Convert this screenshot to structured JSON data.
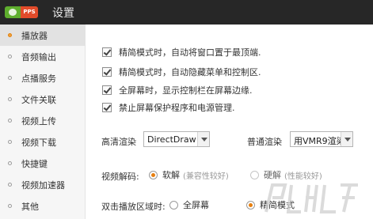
{
  "window": {
    "title": "设置",
    "logo": {
      "badge_text": "PPS",
      "colors": [
        "#5fae2e",
        "#e24b2a"
      ]
    }
  },
  "sidebar": {
    "items": [
      {
        "label": "播放器",
        "active": true
      },
      {
        "label": "音频输出"
      },
      {
        "label": "点播服务"
      },
      {
        "label": "文件关联"
      },
      {
        "label": "视频上传"
      },
      {
        "label": "视频下载"
      },
      {
        "label": "快捷键"
      },
      {
        "label": "视频加速器"
      },
      {
        "label": "其他"
      }
    ]
  },
  "options": [
    {
      "label": "精简模式时，自动将窗口置于最顶端.",
      "checked": true
    },
    {
      "label": "精简模式时，自动隐藏菜单和控制区.",
      "checked": true
    },
    {
      "label": "全屏幕时，显示控制栏在屏幕边缘.",
      "checked": true
    },
    {
      "label": "禁止屏幕保护程序和电源管理.",
      "checked": true
    }
  ],
  "render": {
    "hd_label": "高清渲染",
    "hd_value": "DirectDraw",
    "normal_label": "普通渲染",
    "normal_value": "用VMR9渲染"
  },
  "decode": {
    "label": "视频解码:",
    "soft_label": "软解",
    "soft_note": "(兼容性较好)",
    "hard_label": "硬解",
    "hard_note": "(性能较好)",
    "selected": "soft"
  },
  "dblclick": {
    "label": "双击播放区域时:",
    "fullscreen_label": "全屏幕",
    "compact_label": "精简模式",
    "selected": "compact"
  },
  "accent_color": "#e77f10"
}
